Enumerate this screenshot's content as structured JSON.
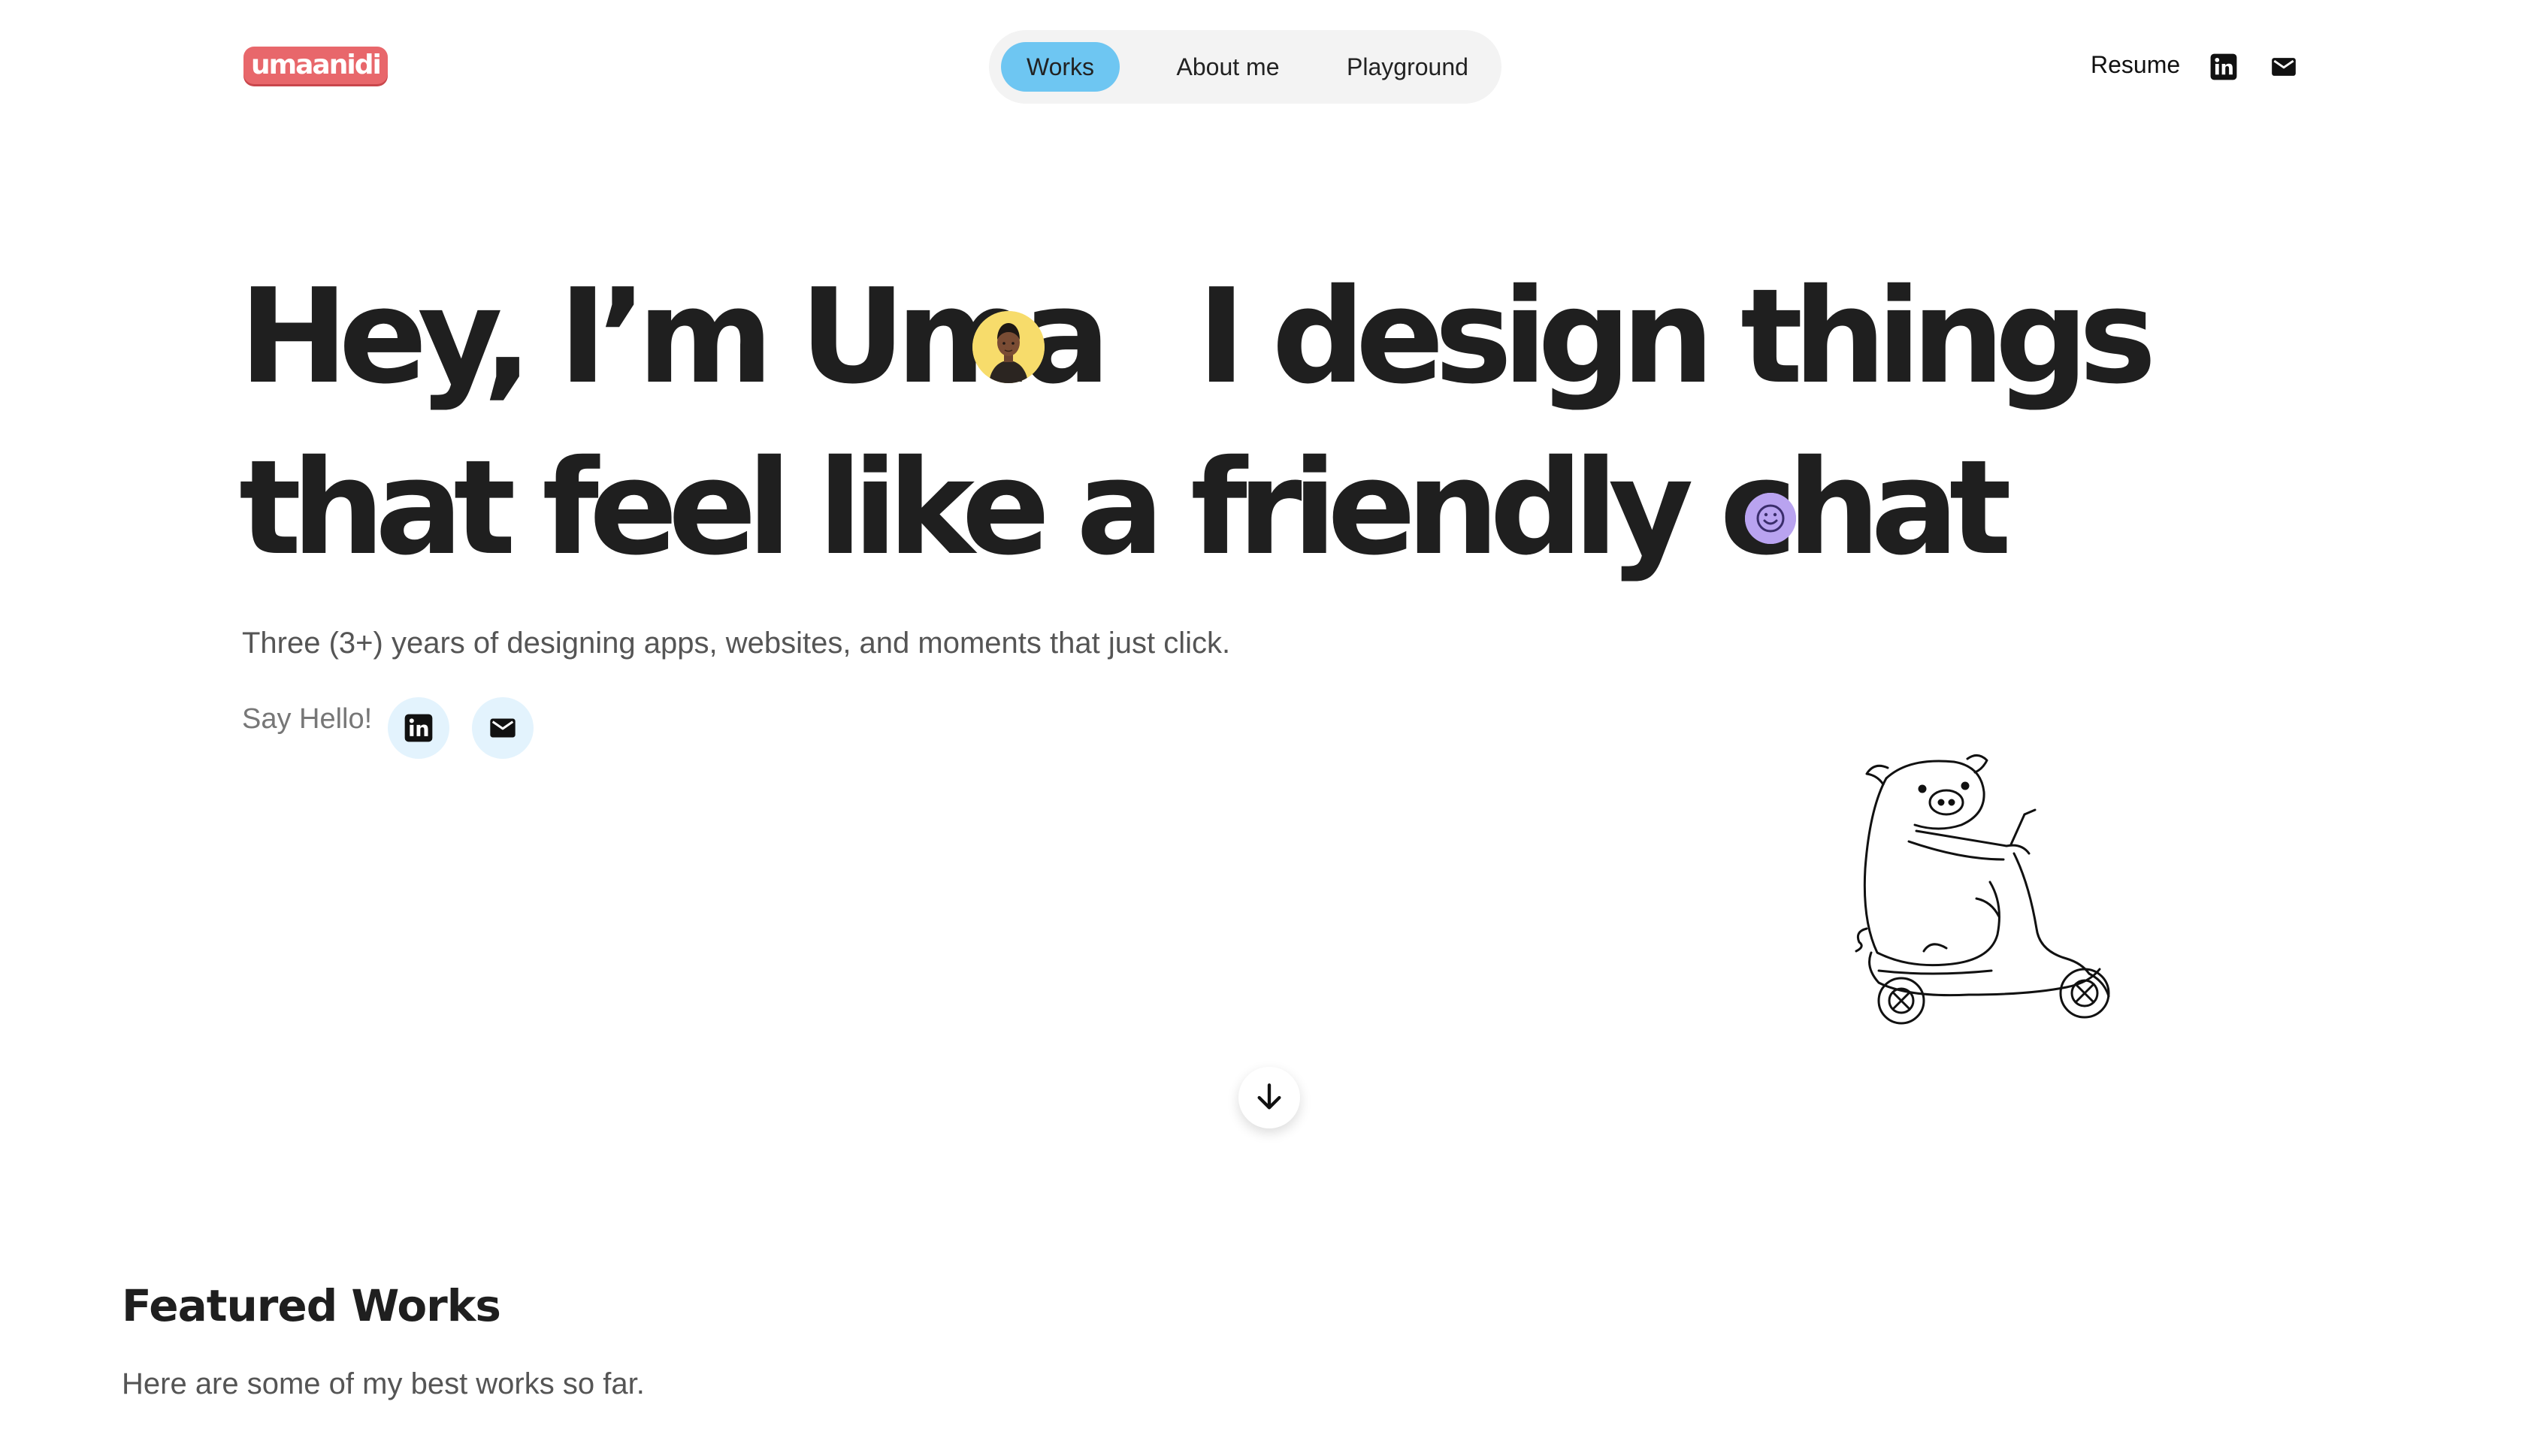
{
  "header": {
    "logo_text": "umaanidi",
    "nav": [
      {
        "label": "Works",
        "active": true
      },
      {
        "label": "About me",
        "active": false
      },
      {
        "label": "Playground",
        "active": false
      }
    ],
    "resume_label": "Resume",
    "icons": [
      "linkedin-icon",
      "mail-icon"
    ]
  },
  "hero": {
    "line1_a": "Hey, I’m Uma",
    "line1_b": "I design things",
    "line2": "that feel like a friendly chat",
    "subtitle": "Three (3+) years of designing apps, websites, and moments that just click.",
    "say_hello": "Say Hello!"
  },
  "featured": {
    "title": "Featured Works",
    "subtitle": "Here are some of my best works so far."
  },
  "colors": {
    "logo": "#e8676b",
    "nav_active": "#6ec6f2",
    "nav_bg": "#f3f3f3",
    "circle_btn_bg": "#e3f3fd",
    "avatar_bg": "#f7dc6b",
    "smile_badge": "#b9a3f0",
    "text_dark": "#1f1f1f"
  }
}
